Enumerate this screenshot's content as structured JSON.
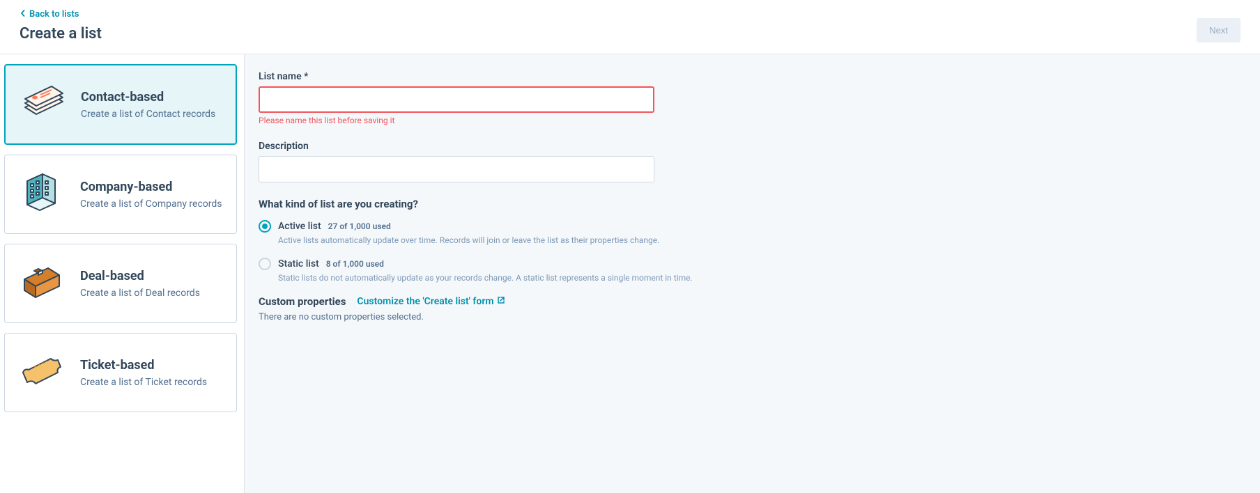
{
  "header": {
    "back_label": "Back to lists",
    "title": "Create a list",
    "next_label": "Next"
  },
  "sidebar": {
    "cards": [
      {
        "title": "Contact-based",
        "desc": "Create a list of Contact records"
      },
      {
        "title": "Company-based",
        "desc": "Create a list of Company records"
      },
      {
        "title": "Deal-based",
        "desc": "Create a list of Deal records"
      },
      {
        "title": "Ticket-based",
        "desc": "Create a list of Ticket records"
      }
    ]
  },
  "form": {
    "list_name_label": "List name *",
    "list_name_value": "",
    "list_name_error": "Please name this list before saving it",
    "description_label": "Description",
    "description_value": "",
    "kind_heading": "What kind of list are you creating?",
    "active": {
      "label": "Active list",
      "usage": "27 of 1,000 used",
      "desc": "Active lists automatically update over time. Records will join or leave the list as their properties change."
    },
    "static": {
      "label": "Static list",
      "usage": "8 of 1,000 used",
      "desc": "Static lists do not automatically update as your records change. A static list represents a single moment in time."
    },
    "custom_label": "Custom properties",
    "custom_link": "Customize the 'Create list' form",
    "custom_text": "There are no custom properties selected."
  }
}
